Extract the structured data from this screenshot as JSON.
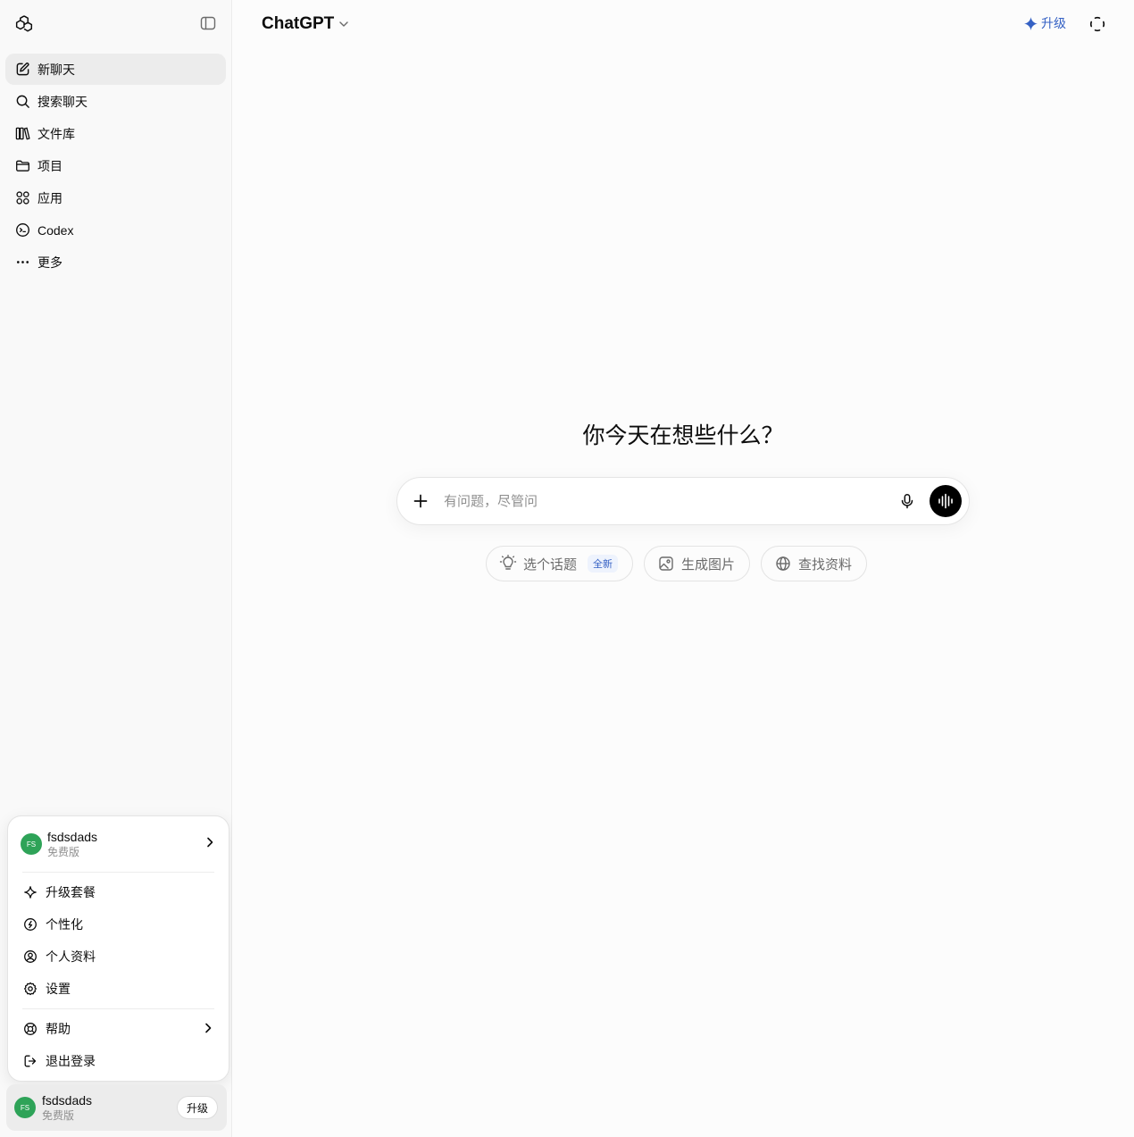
{
  "sidebar": {
    "nav": [
      {
        "label": "新聊天",
        "icon": "edit-icon"
      },
      {
        "label": "搜索聊天",
        "icon": "search-icon"
      },
      {
        "label": "文件库",
        "icon": "library-icon"
      },
      {
        "label": "项目",
        "icon": "folder-icon"
      },
      {
        "label": "应用",
        "icon": "apps-icon"
      },
      {
        "label": "Codex",
        "icon": "codex-icon"
      },
      {
        "label": "更多",
        "icon": "more-icon"
      }
    ]
  },
  "account_menu": {
    "user_name": "fsdsdads",
    "user_plan": "免费版",
    "avatar_initials": "FS",
    "items": [
      {
        "label": "升级套餐",
        "icon": "sparkle-icon"
      },
      {
        "label": "个性化",
        "icon": "personalize-icon"
      },
      {
        "label": "个人资料",
        "icon": "profile-icon"
      },
      {
        "label": "设置",
        "icon": "settings-icon"
      }
    ],
    "help_label": "帮助",
    "logout_label": "退出登录"
  },
  "user_bar": {
    "user_name": "fsdsdads",
    "user_plan": "免费版",
    "avatar_initials": "FS",
    "upgrade_label": "升级"
  },
  "header": {
    "model_name": "ChatGPT",
    "upgrade_label": "升级"
  },
  "main": {
    "heading": "你今天在想些什么？",
    "composer_placeholder": "有问题，尽管问",
    "chips": [
      {
        "label": "选个话题",
        "icon": "lightbulb-icon",
        "badge": "全新"
      },
      {
        "label": "生成图片",
        "icon": "image-icon"
      },
      {
        "label": "查找资料",
        "icon": "globe-icon"
      }
    ]
  },
  "colors": {
    "accent": "#3561c4",
    "avatar": "#2ea358",
    "sidebar_bg": "#f9f9f9",
    "main_bg": "#fcfcfc"
  }
}
